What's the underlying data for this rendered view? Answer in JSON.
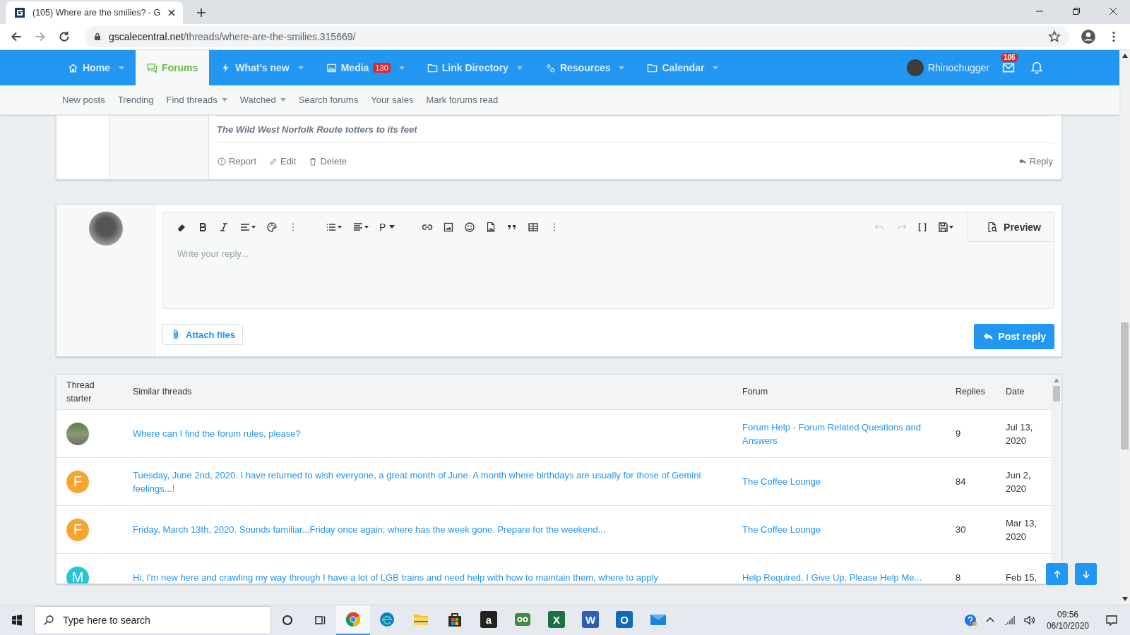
{
  "browser": {
    "tab_title": "(105) Where are the smilies? - G",
    "url_domain": "gscalecentral.net",
    "url_path": "/threads/where-are-the-smilies.315669/"
  },
  "nav": [
    {
      "label": "Home",
      "selected": false,
      "dropdown": true
    },
    {
      "label": "Forums",
      "selected": true,
      "dropdown": false
    },
    {
      "label": "What's new",
      "selected": false,
      "dropdown": true
    },
    {
      "label": "Media",
      "selected": false,
      "dropdown": true,
      "badge": "130"
    },
    {
      "label": "Link Directory",
      "selected": false,
      "dropdown": true
    },
    {
      "label": "Resources",
      "selected": false,
      "dropdown": true
    },
    {
      "label": "Calendar",
      "selected": false,
      "dropdown": true
    }
  ],
  "user": {
    "name": "Rhinochugger",
    "mail_badge": "105"
  },
  "subnav": [
    {
      "label": "New posts",
      "dropdown": false
    },
    {
      "label": "Trending",
      "dropdown": false
    },
    {
      "label": "Find threads",
      "dropdown": true
    },
    {
      "label": "Watched",
      "dropdown": true
    },
    {
      "label": "Search forums",
      "dropdown": false
    },
    {
      "label": "Your sales",
      "dropdown": false
    },
    {
      "label": "Mark forums read",
      "dropdown": false
    }
  ],
  "post": {
    "signature": "The Wild West Norfolk Route totters to its feet",
    "actions": [
      "Report",
      "Edit",
      "Delete"
    ],
    "reply": "Reply"
  },
  "editor": {
    "paragraph_button": "P",
    "placeholder": "Write your reply...",
    "preview": "Preview",
    "attach": "Attach files",
    "submit": "Post reply"
  },
  "similar_threads": {
    "columns": [
      "Thread starter",
      "Similar threads",
      "Forum",
      "Replies",
      "Date"
    ],
    "rows": [
      {
        "avatar": {
          "kind": "photo"
        },
        "title": "Where can I find the forum rules, please?",
        "forum": "Forum Help - Forum Related Questions and Answers",
        "replies": "9",
        "date": "Jul 13, 2020"
      },
      {
        "avatar": {
          "kind": "letter",
          "letter": "F",
          "color": "#f7a532"
        },
        "title": "Tuesday, June 2nd, 2020. I have returned to wish everyone, a great month of June. A month where birthdays are usually for those of Gemini feelings...!",
        "forum": "The Coffee Lounge",
        "replies": "84",
        "date": "Jun 2, 2020"
      },
      {
        "avatar": {
          "kind": "letter",
          "letter": "F",
          "color": "#f7a532"
        },
        "title": "Friday, March 13th, 2020. Sounds familiar...Friday once again; where has the week gone. Prepare for the weekend...",
        "forum": "The Coffee Lounge",
        "replies": "30",
        "date": "Mar 13, 2020"
      },
      {
        "avatar": {
          "kind": "letter",
          "letter": "M",
          "color": "#26c6da"
        },
        "title": "Hi, I'm new here and crawling my way through I have a lot of LGB trains and need help with how to maintain them, where to apply",
        "forum": "Help Required, I Give Up, Please Help Me...",
        "replies": "8",
        "date": "Feb 15,"
      }
    ]
  },
  "taskbar": {
    "search_placeholder": "Type here to search",
    "apps": [
      {
        "selected": true
      },
      {
        "selected": false
      },
      {
        "selected": false
      },
      {
        "selected": false
      },
      {
        "selected": false,
        "letter": "a"
      },
      {
        "selected": false
      },
      {
        "selected": false,
        "letter": "X"
      },
      {
        "selected": false,
        "letter": "W"
      },
      {
        "selected": false,
        "letter": "O"
      },
      {
        "selected": false
      }
    ],
    "time": "09:56",
    "date": "06/10/2020"
  }
}
